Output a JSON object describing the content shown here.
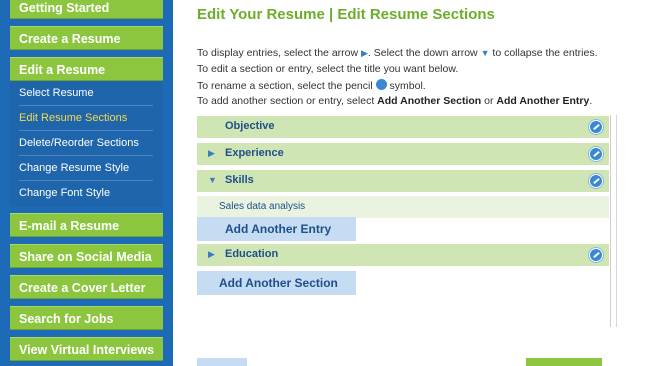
{
  "sidebar": {
    "nav_top": [
      "Getting Started",
      "Create a Resume",
      "Edit a Resume"
    ],
    "sub_items": [
      "Select Resume",
      "Edit Resume Sections",
      "Delete/Reorder Sections",
      "Change Resume Style",
      "Change Font Style"
    ],
    "active_sub": "Edit Resume Sections",
    "nav_bottom": [
      "E-mail a Resume",
      "Share on Social Media",
      "Create a Cover Letter",
      "Search for Jobs",
      "View Virtual Interviews"
    ]
  },
  "main": {
    "title": "Edit Your Resume | Edit Resume Sections",
    "instructions": {
      "line1_a": "To display entries, select the arrow",
      "line1_b": ". Select the down arrow",
      "line1_c": "to collapse the entries.",
      "line2": "To edit a section or entry, select the title you want below.",
      "line3_a": "To rename a section, select the pencil",
      "line3_b": "symbol.",
      "line4_a": "To add another section or entry, select",
      "line4_b": "Add Another Section",
      "line4_c": "or",
      "line4_d": "Add Another Entry",
      "line4_e": "."
    },
    "sections": [
      {
        "label": "Objective",
        "toggle": ""
      },
      {
        "label": "Experience",
        "toggle": "▶"
      },
      {
        "label": "Skills",
        "toggle": "▼"
      },
      {
        "label": "Education",
        "toggle": "▶"
      }
    ],
    "skills_entry": "Sales data analysis",
    "add_entry_label": "Add Another Entry",
    "add_section_label": "Add Another Section"
  },
  "colors": {
    "sidebar_bg": "#1d6ab6",
    "nav_green": "#8cc63f",
    "active_yellow": "#f6d84c",
    "title_green": "#6cae2b",
    "row_green": "#cfe6b4",
    "button_blue": "#c6dcf2"
  },
  "icons": {
    "pencil": "pencil-icon",
    "expand": "expand-arrow-icon",
    "collapse": "collapse-arrow-icon"
  }
}
